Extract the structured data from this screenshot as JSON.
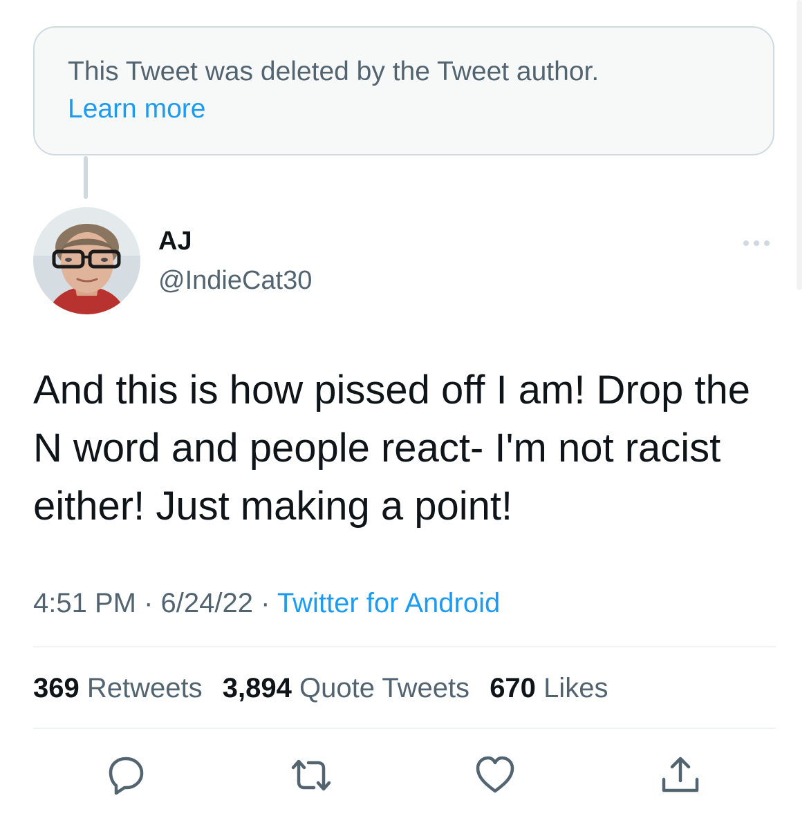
{
  "deleted_notice": {
    "text": "This Tweet was deleted by the Tweet author.",
    "link": "Learn more"
  },
  "author": {
    "display_name": "AJ",
    "handle": "@IndieCat30"
  },
  "tweet": {
    "text": "And this is how pissed off I am! Drop the N word and people react- I'm not racist either! Just making a point!",
    "time": "4:51 PM",
    "separator": "·",
    "date": "6/24/22",
    "source": "Twitter for Android"
  },
  "stats": {
    "retweets_count": "369",
    "retweets_label": "Retweets",
    "quotes_count": "3,894",
    "quotes_label": "Quote Tweets",
    "likes_count": "670",
    "likes_label": "Likes"
  },
  "icons": {
    "reply": "reply-icon",
    "retweet": "retweet-icon",
    "like": "heart-icon",
    "share": "share-icon",
    "more": "more-icon"
  },
  "colors": {
    "link": "#1d9bf0",
    "secondary_text": "#536471",
    "primary_text": "#0f1419",
    "border": "#cfd9de"
  }
}
